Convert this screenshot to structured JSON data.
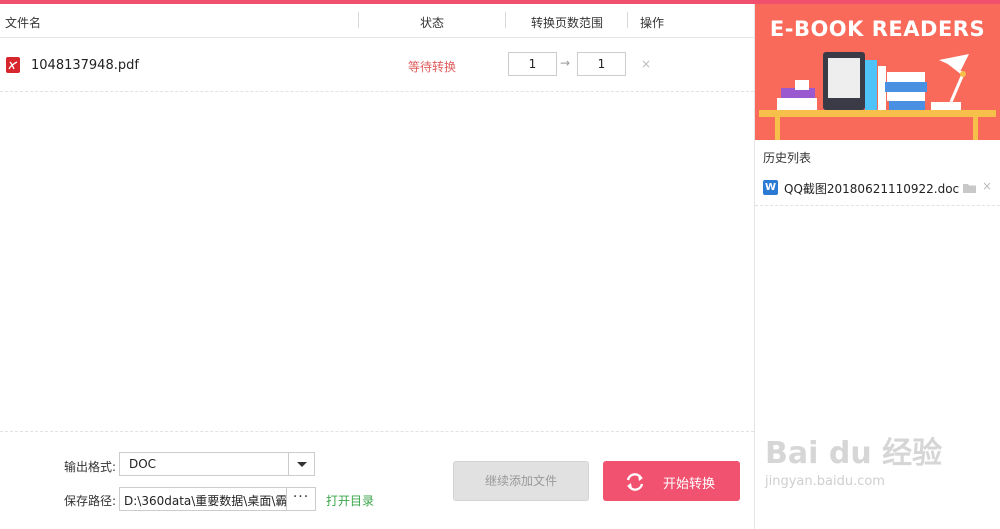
{
  "table": {
    "headers": {
      "filename": "文件名",
      "status": "状态",
      "page_range": "转换页数范围",
      "action": "操作"
    },
    "rows": [
      {
        "filename": "1048137948.pdf",
        "status": "等待转换",
        "page_from": "1",
        "page_to": "1",
        "delete_label": "×"
      }
    ]
  },
  "settings": {
    "output_format_label": "输出格式:",
    "output_format_value": "DOC",
    "save_path_label": "保存路径:",
    "save_path_value": "D:\\360data\\重要数据\\桌面\\霸",
    "browse_label": "···",
    "open_dir_label": "打开目录"
  },
  "buttons": {
    "add_files": "继续添加文件",
    "start_convert": "开始转换"
  },
  "sidebar": {
    "banner_title": "E-BOOK READERS",
    "history_title": "历史列表",
    "history_items": [
      {
        "icon": "W",
        "name": "QQ截图20180621110922.doc",
        "delete_label": "×"
      }
    ]
  },
  "watermark": {
    "brand": "Bai du 经验",
    "url": "jingyan.baidu.com"
  },
  "colors": {
    "accent": "#f15270",
    "status_waiting": "#e05b5b",
    "open_dir": "#3aa64a",
    "banner_bg": "#f96a5b",
    "word_icon": "#2b7bd5",
    "pdf_icon": "#d8262f"
  }
}
